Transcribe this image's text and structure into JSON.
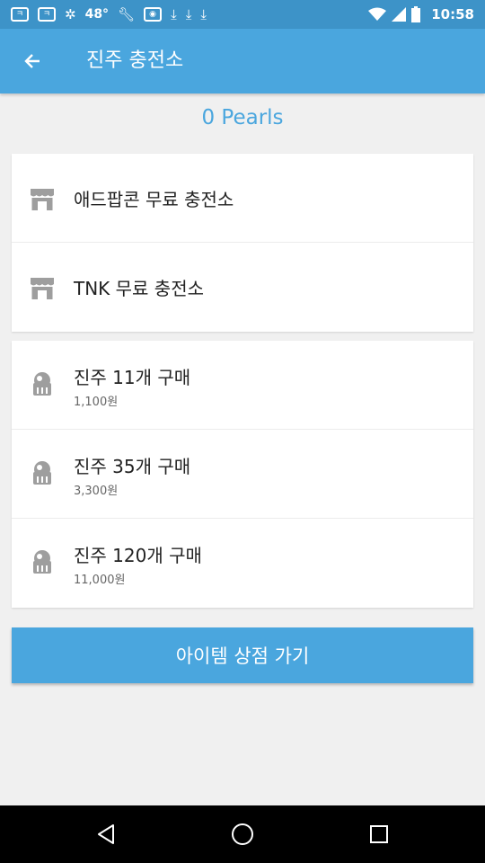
{
  "status_bar": {
    "temperature": "48°",
    "time": "10:58",
    "icons": [
      "message-icon",
      "message-icon",
      "settings-icon",
      "temperature",
      "wrench-icon",
      "gamepad-icon",
      "download-icon",
      "download-icon",
      "download-icon",
      "wifi-icon",
      "signal-icon",
      "battery-icon"
    ]
  },
  "app_bar": {
    "title": "진주 충전소",
    "back_icon": "arrow-left-icon"
  },
  "balance": {
    "text": "0 Pearls"
  },
  "free_charge": [
    {
      "label": "애드팝콘 무료 충전소",
      "icon": "store-icon"
    },
    {
      "label": "TNK 무료 충전소",
      "icon": "store-icon"
    }
  ],
  "purchases": [
    {
      "label": "진주 11개 구매",
      "price": "1,100원",
      "icon": "pearl-icon"
    },
    {
      "label": "진주 35개 구매",
      "price": "3,300원",
      "icon": "pearl-icon"
    },
    {
      "label": "진주 120개 구매",
      "price": "11,000원",
      "icon": "pearl-icon"
    }
  ],
  "shop_button": {
    "label": "아이템 상점 가기"
  },
  "colors": {
    "status_bar": "#3d93c8",
    "app_bar": "#4aa6de",
    "accent": "#4aa6de",
    "background": "#f0f0f0",
    "icon_gray": "#9e9e9e"
  }
}
